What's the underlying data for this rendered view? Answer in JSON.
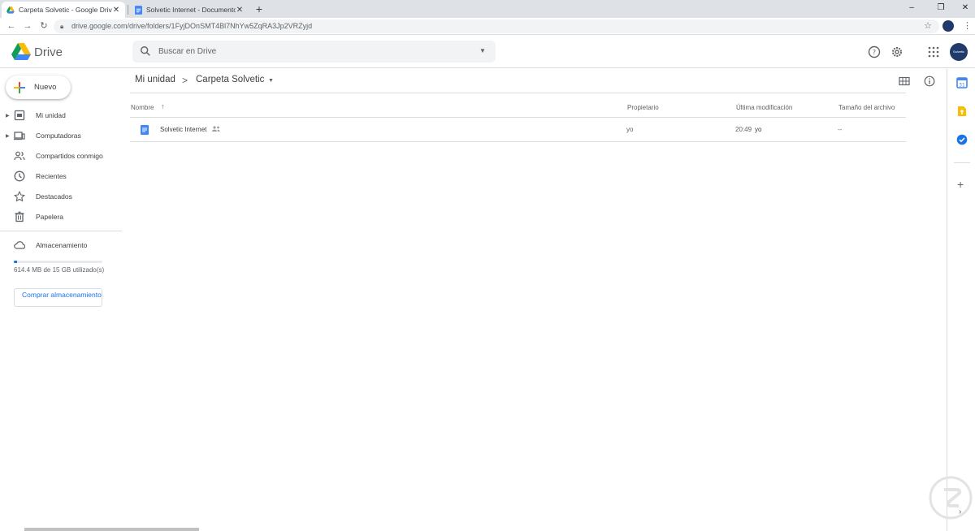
{
  "browser": {
    "tabs": [
      {
        "title": "Carpeta Solvetic - Google Drive",
        "active": true
      },
      {
        "title": "Solvetic Internet - Documentos d",
        "active": false
      }
    ],
    "close_glyph": "✕",
    "newtab_glyph": "+",
    "url": "drive.google.com/drive/folders/1FyjDOnSMT4Bl7NhYw5ZqRA3Jp2VRZyjd",
    "window_controls": [
      "–",
      "❐",
      "✕"
    ]
  },
  "header": {
    "app_name": "Drive",
    "search_placeholder": "Buscar en Drive",
    "avatar_text": "Solvetic"
  },
  "sidebar": {
    "new_label": "Nuevo",
    "items": [
      {
        "label": "Mi unidad",
        "icon": "my-drive-icon",
        "expandable": true
      },
      {
        "label": "Computadoras",
        "icon": "computers-icon",
        "expandable": true
      },
      {
        "label": "Compartidos conmigo",
        "icon": "shared-icon",
        "expandable": false
      },
      {
        "label": "Recientes",
        "icon": "clock-icon",
        "expandable": false
      },
      {
        "label": "Destacados",
        "icon": "star-icon",
        "expandable": false
      },
      {
        "label": "Papelera",
        "icon": "trash-icon",
        "expandable": false
      }
    ],
    "storage_label": "Almacenamiento",
    "storage_text": "614.4 MB de 15 GB utilizado(s)",
    "storage_fraction": 0.04,
    "buy_label": "Comprar almacenamiento"
  },
  "main": {
    "breadcrumb": [
      "Mi unidad",
      "Carpeta Solvetic"
    ],
    "columns": {
      "name": "Nombre",
      "owner": "Propietario",
      "modified": "Última modificación",
      "size": "Tamaño del archivo"
    },
    "files": [
      {
        "name": "Solvetic Internet",
        "owner": "yo",
        "modified_time": "20:49",
        "modified_by": "yo",
        "size": "--",
        "icon": "docs-icon",
        "shared": true
      }
    ]
  },
  "colors": {
    "accent": "#1a73e8",
    "docs_blue": "#4285f4",
    "keep_yellow": "#fbbc04",
    "avatar": "#1f3a6b"
  }
}
